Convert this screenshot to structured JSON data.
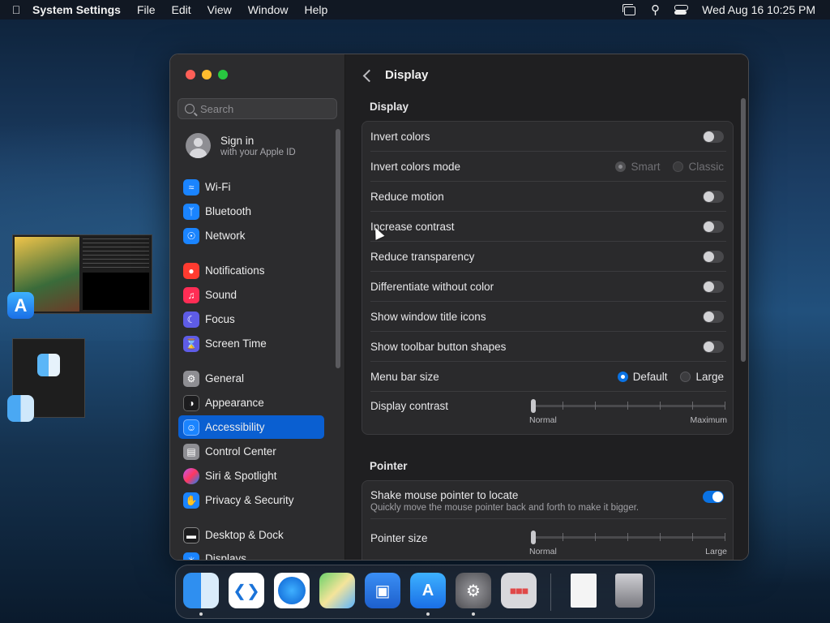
{
  "menubar": {
    "app_name": "System Settings",
    "menus": [
      "File",
      "Edit",
      "View",
      "Window",
      "Help"
    ],
    "clock": "Wed Aug 16  10:25 PM"
  },
  "sidebar": {
    "search_placeholder": "Search",
    "account": {
      "title": "Sign in",
      "subtitle": "with your Apple ID"
    },
    "items": [
      {
        "label": "Wi-Fi",
        "icon": "wifi-icon",
        "color": "#1a84ff"
      },
      {
        "label": "Bluetooth",
        "icon": "bluetooth-icon",
        "color": "#1a84ff"
      },
      {
        "label": "Network",
        "icon": "globe-icon",
        "color": "#1a84ff"
      },
      {
        "label": "Notifications",
        "icon": "bell-icon",
        "color": "#ff3b30"
      },
      {
        "label": "Sound",
        "icon": "speaker-icon",
        "color": "#ff2d55"
      },
      {
        "label": "Focus",
        "icon": "moon-icon",
        "color": "#5e5ce6"
      },
      {
        "label": "Screen Time",
        "icon": "hourglass-icon",
        "color": "#5e5ce6"
      },
      {
        "label": "General",
        "icon": "gear-icon",
        "color": "#8e8e93"
      },
      {
        "label": "Appearance",
        "icon": "appearance-icon",
        "color": "#1c1c1e"
      },
      {
        "label": "Accessibility",
        "icon": "accessibility-icon",
        "color": "#1a84ff"
      },
      {
        "label": "Control Center",
        "icon": "control-center-icon",
        "color": "#8e8e93"
      },
      {
        "label": "Siri & Spotlight",
        "icon": "siri-icon",
        "color": "#bf5af2"
      },
      {
        "label": "Privacy & Security",
        "icon": "hand-icon",
        "color": "#1a84ff"
      },
      {
        "label": "Desktop & Dock",
        "icon": "dock-icon",
        "color": "#1c1c1e"
      },
      {
        "label": "Displays",
        "icon": "display-icon",
        "color": "#1a84ff"
      }
    ],
    "active_item": "Accessibility"
  },
  "main": {
    "title": "Display",
    "display_section": {
      "title": "Display",
      "rows": {
        "invert_colors": {
          "label": "Invert colors",
          "on": false
        },
        "invert_mode": {
          "label": "Invert colors mode",
          "options": [
            "Smart",
            "Classic"
          ],
          "selected": "Smart",
          "disabled": true
        },
        "reduce_motion": {
          "label": "Reduce motion",
          "on": false
        },
        "increase_contrast": {
          "label": "Increase contrast",
          "on": false
        },
        "reduce_transparency": {
          "label": "Reduce transparency",
          "on": false
        },
        "differentiate": {
          "label": "Differentiate without color",
          "on": false
        },
        "window_title_icons": {
          "label": "Show window title icons",
          "on": false
        },
        "toolbar_shapes": {
          "label": "Show toolbar button shapes",
          "on": false
        },
        "menu_bar_size": {
          "label": "Menu bar size",
          "options": [
            "Default",
            "Large"
          ],
          "selected": "Default"
        },
        "display_contrast": {
          "label": "Display contrast",
          "min_label": "Normal",
          "max_label": "Maximum",
          "value": 0
        }
      }
    },
    "pointer_section": {
      "title": "Pointer",
      "shake": {
        "label": "Shake mouse pointer to locate",
        "description": "Quickly move the mouse pointer back and forth to make it bigger.",
        "on": true
      },
      "pointer_size": {
        "label": "Pointer size",
        "min_label": "Normal",
        "max_label": "Large",
        "value": 0
      }
    }
  },
  "dock": {
    "apps": [
      "finder-icon",
      "vscode-icon",
      "safari-icon",
      "maps-icon",
      "keynote-icon",
      "app-store-icon",
      "system-settings-icon",
      "launchpad-icon",
      "document-icon",
      "trash-icon"
    ]
  }
}
